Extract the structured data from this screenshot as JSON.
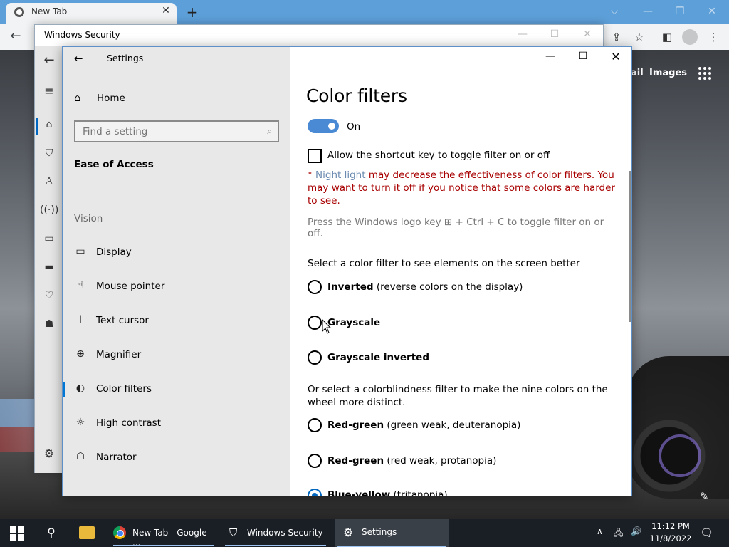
{
  "browser": {
    "tab_title": "New Tab",
    "tab_close": "✕",
    "new_tab": "+",
    "window_min": "—",
    "window_max": "❐",
    "window_close": "✕",
    "back": "←",
    "gmail_partial": "ail",
    "images_link": "Images",
    "edit": "✎"
  },
  "security_window": {
    "title": "Windows Security",
    "min": "—",
    "max": "☐",
    "close": "✕",
    "icons": [
      "back-arrow-icon",
      "hamburger-menu-icon",
      "home-icon",
      "shield-icon",
      "account-icon",
      "firewall-network-icon",
      "app-browser-control-icon",
      "device-security-icon",
      "device-health-icon",
      "family-options-icon",
      "settings-gear-icon"
    ]
  },
  "settings": {
    "title": "Settings",
    "back": "←",
    "min": "—",
    "max": "☐",
    "close": "✕",
    "home_label": "Home",
    "search_placeholder": "Find a setting",
    "category": "Ease of Access",
    "section_vision": "Vision",
    "nav_items": [
      {
        "label": "Display",
        "icon": "display-icon",
        "glyph": "▭"
      },
      {
        "label": "Mouse pointer",
        "icon": "mouse-pointer-icon",
        "glyph": "☝"
      },
      {
        "label": "Text cursor",
        "icon": "text-cursor-icon",
        "glyph": "Ι"
      },
      {
        "label": "Magnifier",
        "icon": "magnifier-icon",
        "glyph": "⊕"
      },
      {
        "label": "Color filters",
        "icon": "color-filters-icon",
        "glyph": "◐"
      },
      {
        "label": "High contrast",
        "icon": "high-contrast-icon",
        "glyph": "☼"
      },
      {
        "label": "Narrator",
        "icon": "narrator-icon",
        "glyph": "☖"
      }
    ],
    "active_item": "Color filters"
  },
  "color_filters": {
    "title": "Color filters",
    "toggle_label": "On",
    "toggle_on": true,
    "shortcut_checkbox_label": "Allow the shortcut key to toggle filter on or off",
    "shortcut_checked": false,
    "warning_prefix": "* ",
    "warning_link": "Night light",
    "warning_text": " may decrease the effectiveness of color filters. You may want to turn it off if you notice that some colors are harder to see.",
    "hint": "Press the Windows logo key ⊞ + Ctrl + C to toggle filter on or off.",
    "select_label": "Select a color filter to see elements on the screen better",
    "filters": [
      {
        "name": "Inverted",
        "desc": " (reverse colors on the display)"
      },
      {
        "name": "Grayscale",
        "desc": ""
      },
      {
        "name": "Grayscale inverted",
        "desc": ""
      }
    ],
    "colorblind_label": "Or select a colorblindness filter to make the nine colors on the wheel more distinct.",
    "colorblind_filters": [
      {
        "name": "Red-green",
        "desc": " (green weak, deuteranopia)"
      },
      {
        "name": "Red-green",
        "desc": " (red weak, protanopia)"
      },
      {
        "name": "Blue-yellow",
        "desc": " (tritanopia)"
      }
    ],
    "selected_filter": "Blue-yellow"
  },
  "taskbar": {
    "chrome_label": "New Tab - Google ...",
    "security_label": "Windows Security",
    "settings_label": "Settings",
    "tray_up": "∧",
    "tray_net": "🖧",
    "tray_vol": "🔊",
    "time": "11:12 PM",
    "date": "11/8/2022",
    "notification": "🗨"
  },
  "colors": {
    "accent": "#0078d4",
    "toggle_on": "#4a8ad4",
    "warning_text": "#a80000",
    "taskbar": "#1a1f26"
  }
}
